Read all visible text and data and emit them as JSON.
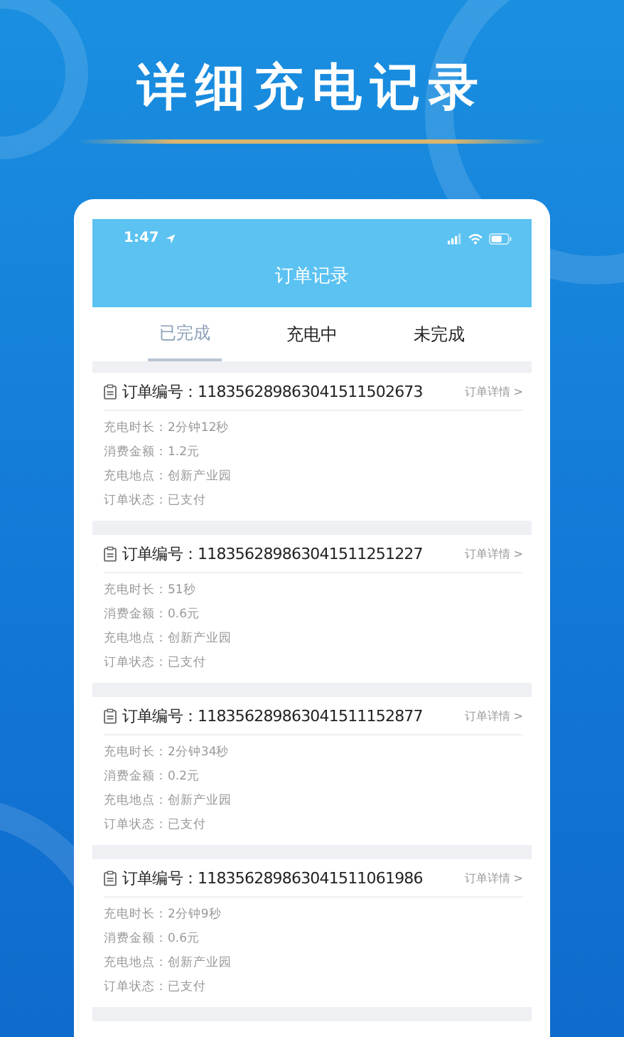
{
  "headline": "详细充电记录",
  "status_bar": {
    "time": "1:47"
  },
  "header": {
    "title": "订单记录"
  },
  "tabs": [
    {
      "label": "已完成",
      "selected": true
    },
    {
      "label": "充电中",
      "selected": false
    },
    {
      "label": "未完成",
      "selected": false
    }
  ],
  "orders": [
    {
      "number_label": "订单编号：",
      "number": "118356289863041511502673",
      "detail_link": "订单详情 >",
      "fields": [
        {
          "label": "充电时长：",
          "value": "2分钟12秒"
        },
        {
          "label": "消费金额：",
          "value": "1.2元"
        },
        {
          "label": "充电地点：",
          "value": "创新产业园"
        },
        {
          "label": "订单状态：",
          "value": "已支付"
        }
      ]
    },
    {
      "number_label": "订单编号：",
      "number": "118356289863041511251227",
      "detail_link": "订单详情 >",
      "fields": [
        {
          "label": "充电时长：",
          "value": "51秒"
        },
        {
          "label": "消费金额：",
          "value": "0.6元"
        },
        {
          "label": "充电地点：",
          "value": "创新产业园"
        },
        {
          "label": "订单状态：",
          "value": "已支付"
        }
      ]
    },
    {
      "number_label": "订单编号：",
      "number": "118356289863041511152877",
      "detail_link": "订单详情 >",
      "fields": [
        {
          "label": "充电时长：",
          "value": "2分钟34秒"
        },
        {
          "label": "消费金额：",
          "value": "0.2元"
        },
        {
          "label": "充电地点：",
          "value": "创新产业园"
        },
        {
          "label": "订单状态：",
          "value": "已支付"
        }
      ]
    },
    {
      "number_label": "订单编号：",
      "number": "118356289863041511061986",
      "detail_link": "订单详情 >",
      "fields": [
        {
          "label": "充电时长：",
          "value": "2分钟9秒"
        },
        {
          "label": "消费金额：",
          "value": "0.6元"
        },
        {
          "label": "充电地点：",
          "value": "创新产业园"
        },
        {
          "label": "订单状态：",
          "value": "已支付"
        }
      ]
    }
  ]
}
